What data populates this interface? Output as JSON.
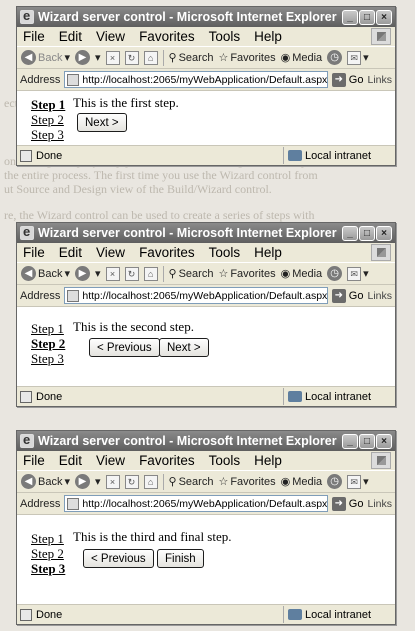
{
  "windows": [
    {
      "title": "Wizard server control - Microsoft Internet Explorer",
      "step_text": "This is the first step.",
      "active_step": 1,
      "buttons": [
        "Next >"
      ]
    },
    {
      "title": "Wizard server control - Microsoft Internet Explorer",
      "step_text": "This is the second step.",
      "active_step": 2,
      "buttons": [
        "< Previous",
        "Next >"
      ]
    },
    {
      "title": "Wizard server control - Microsoft Internet Explorer",
      "step_text": "This is the third and final step.",
      "active_step": 3,
      "buttons": [
        "< Previous",
        "Finish"
      ]
    }
  ],
  "menu": [
    "File",
    "Edit",
    "View",
    "Favorites",
    "Tools",
    "Help"
  ],
  "toolbar": {
    "back": "Back",
    "search": "Search",
    "favorites": "Favorites",
    "media": "Media"
  },
  "address": {
    "label": "Address",
    "url": "http://localhost:2065/myWebApplication/Default.aspx",
    "go": "Go",
    "links": "Links"
  },
  "steps": [
    "Step 1",
    "Step 2",
    "Step 3"
  ],
  "status": {
    "left": "Done",
    "zone": "Local intranet"
  },
  "colors": {
    "titlebar": "#6e6e6e",
    "chrome": "#ece9d8",
    "content": "#ffffff"
  }
}
